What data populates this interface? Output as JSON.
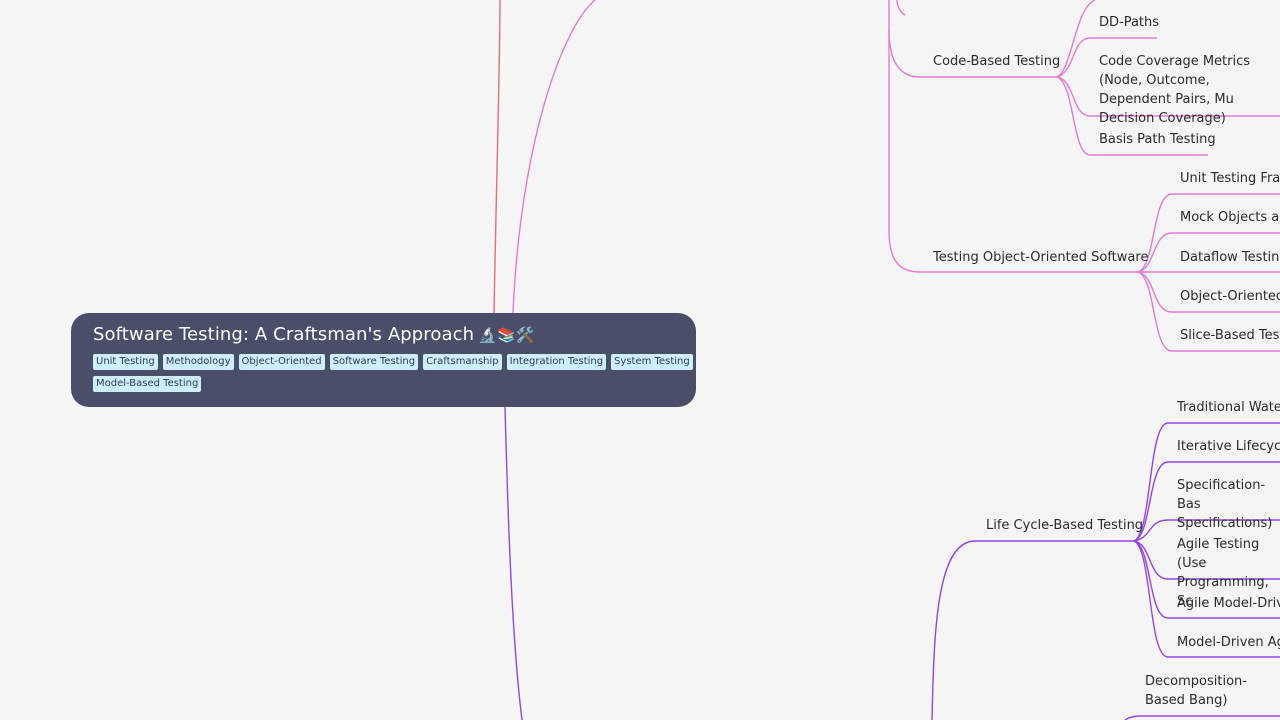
{
  "root": {
    "title": "Software Testing: A Craftsman's Approach",
    "emoji": "🔬📚🛠️",
    "tags": [
      "Unit Testing",
      "Methodology",
      "Object-Oriented",
      "Software Testing",
      "Craftsmanship",
      "Integration Testing",
      "System Testing",
      "Model-Based Testing"
    ]
  },
  "nodes": {
    "code_based_testing": "Code-Based Testing",
    "dd_paths": "DD-Paths",
    "code_coverage_metrics": "Code Coverage Metrics (Node, Outcome, Dependent Pairs, Mu Decision Coverage)",
    "basis_path_testing": "Basis Path Testing",
    "testing_oo_software": "Testing Object-Oriented Software",
    "unit_testing_frameworks": "Unit Testing Fram",
    "mock_objects": "Mock Objects and",
    "dataflow_testing": "Dataflow Testing",
    "object_oriented": "Object-Oriented",
    "slice_based_testing": "Slice-Based Testi",
    "life_cycle_based_testing": "Life Cycle-Based Testing",
    "traditional_waterfall": "Traditional Water",
    "iterative_lifecycle": "Iterative Lifecycle",
    "specification_based": "Specification-Bas Specifications)",
    "agile_testing": "Agile Testing (Use Programming, Sc",
    "agile_model_driven": "Agile Model-Drive",
    "model_driven_agile": "Model-Driven Agi",
    "decomposition_based": "Decomposition-Based Bang)"
  },
  "colors": {
    "root_bg": "#4a4e69",
    "tag_bg": "#cdeefb",
    "branch_red": "#e07070",
    "branch_pink": "#e57ad6",
    "branch_purple": "#9544e8"
  }
}
